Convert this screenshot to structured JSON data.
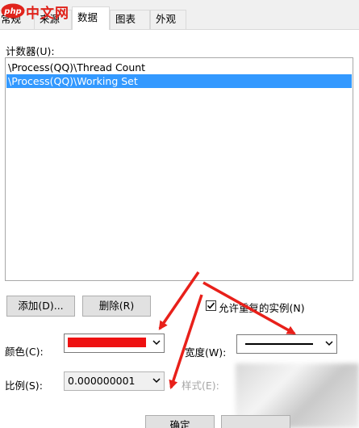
{
  "logo": {
    "badge": "php",
    "text": "中文网"
  },
  "tabs": [
    {
      "label": "常规",
      "active": false
    },
    {
      "label": "来源",
      "active": false
    },
    {
      "label": "数据",
      "active": true
    },
    {
      "label": "图表",
      "active": false
    },
    {
      "label": "外观",
      "active": false
    }
  ],
  "counters": {
    "label": "计数器(U):",
    "items": [
      {
        "text": "\\Process(QQ)\\Thread Count",
        "selected": false
      },
      {
        "text": "\\Process(QQ)\\Working Set",
        "selected": true
      }
    ]
  },
  "buttons": {
    "add": "添加(D)...",
    "remove": "删除(R)",
    "ok": "确定"
  },
  "allow_duplicates": {
    "label": "允许重复的实例(N)",
    "checked": true
  },
  "color": {
    "label": "颜色(C):",
    "value_hex": "#ee1111"
  },
  "width": {
    "label": "宽度(W):"
  },
  "scale": {
    "label": "比例(S):",
    "value": "0.000000001"
  },
  "style": {
    "label": "样式(E):"
  },
  "colors": {
    "selection": "#3399ff",
    "annotation_arrow": "#e8201a"
  },
  "icons": {
    "dropdown": "chevron-down-icon",
    "checkbox": "checkmark-icon"
  }
}
